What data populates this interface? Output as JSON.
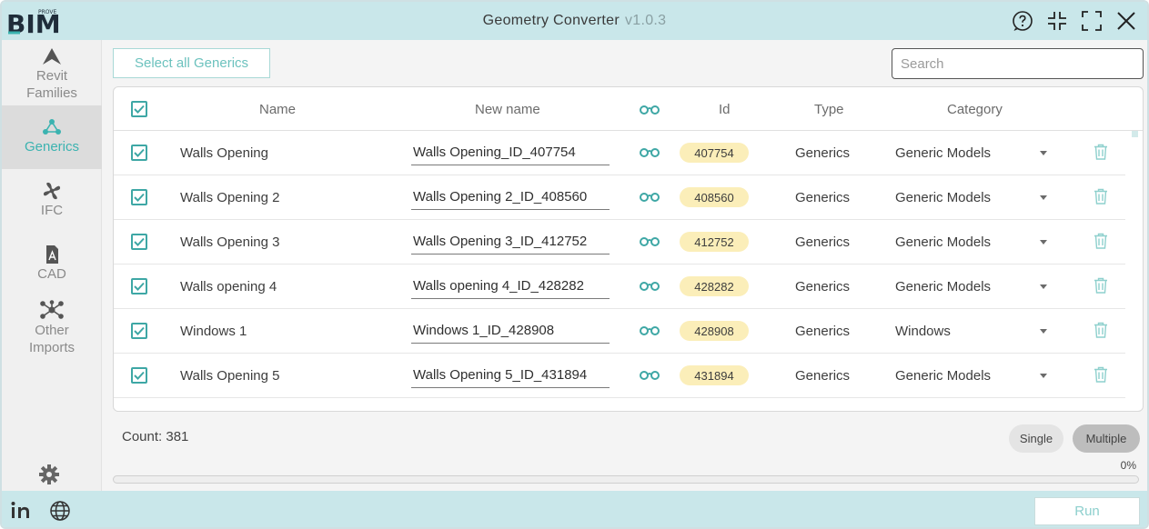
{
  "app": {
    "title": "Geometry Converter",
    "version": "v1.0.3",
    "logo_text": "BIM",
    "logo_sup": "PROVE"
  },
  "titlebar_icons": [
    "help-icon",
    "collapse-icon",
    "expand-icon",
    "close-icon"
  ],
  "sidebar": {
    "items": [
      {
        "label_lines": [
          "Revit",
          "Families"
        ],
        "icon": "revit-icon",
        "active": false
      },
      {
        "label_lines": [
          "Generics"
        ],
        "icon": "generics-icon",
        "active": true
      },
      {
        "label_lines": [
          "IFC"
        ],
        "icon": "ifc-icon",
        "active": false
      },
      {
        "label_lines": [
          "CAD"
        ],
        "icon": "cad-icon",
        "active": false
      },
      {
        "label_lines": [
          "Other",
          "Imports"
        ],
        "icon": "other-imports-icon",
        "active": false
      }
    ],
    "settings_icon": "gear-icon"
  },
  "toolbar": {
    "select_all_label": "Select all Generics",
    "search_placeholder": "Search"
  },
  "table": {
    "headers": {
      "name": "Name",
      "new_name": "New name",
      "id": "Id",
      "type": "Type",
      "category": "Category"
    },
    "rows": [
      {
        "checked": true,
        "name": "Walls Opening",
        "new_name": "Walls Opening_ID_407754",
        "id": "407754",
        "type": "Generics",
        "category": "Generic Models"
      },
      {
        "checked": true,
        "name": "Walls Opening 2",
        "new_name": "Walls Opening 2_ID_408560",
        "id": "408560",
        "type": "Generics",
        "category": "Generic Models"
      },
      {
        "checked": true,
        "name": "Walls Opening 3",
        "new_name": "Walls Opening 3_ID_412752",
        "id": "412752",
        "type": "Generics",
        "category": "Generic Models"
      },
      {
        "checked": true,
        "name": "Walls opening 4",
        "new_name": "Walls opening 4_ID_428282",
        "id": "428282",
        "type": "Generics",
        "category": "Generic Models"
      },
      {
        "checked": true,
        "name": "Windows 1",
        "new_name": "Windows 1_ID_428908",
        "id": "428908",
        "type": "Generics",
        "category": "Windows"
      },
      {
        "checked": true,
        "name": "Walls Opening 5",
        "new_name": "Walls Opening 5_ID_431894",
        "id": "431894",
        "type": "Generics",
        "category": "Generic Models"
      }
    ]
  },
  "status": {
    "count_label": "Count: 381",
    "mode_single": "Single",
    "mode_multiple": "Multiple",
    "mode_selected": "Multiple",
    "progress_text": "0%",
    "progress_value": 0
  },
  "footer": {
    "run_label": "Run",
    "icons": [
      "linkedin-icon",
      "globe-icon"
    ]
  },
  "colors": {
    "accent": "#3bb3b0",
    "titlebar": "#c9e7ea",
    "id_pill": "#fbeeb9"
  }
}
